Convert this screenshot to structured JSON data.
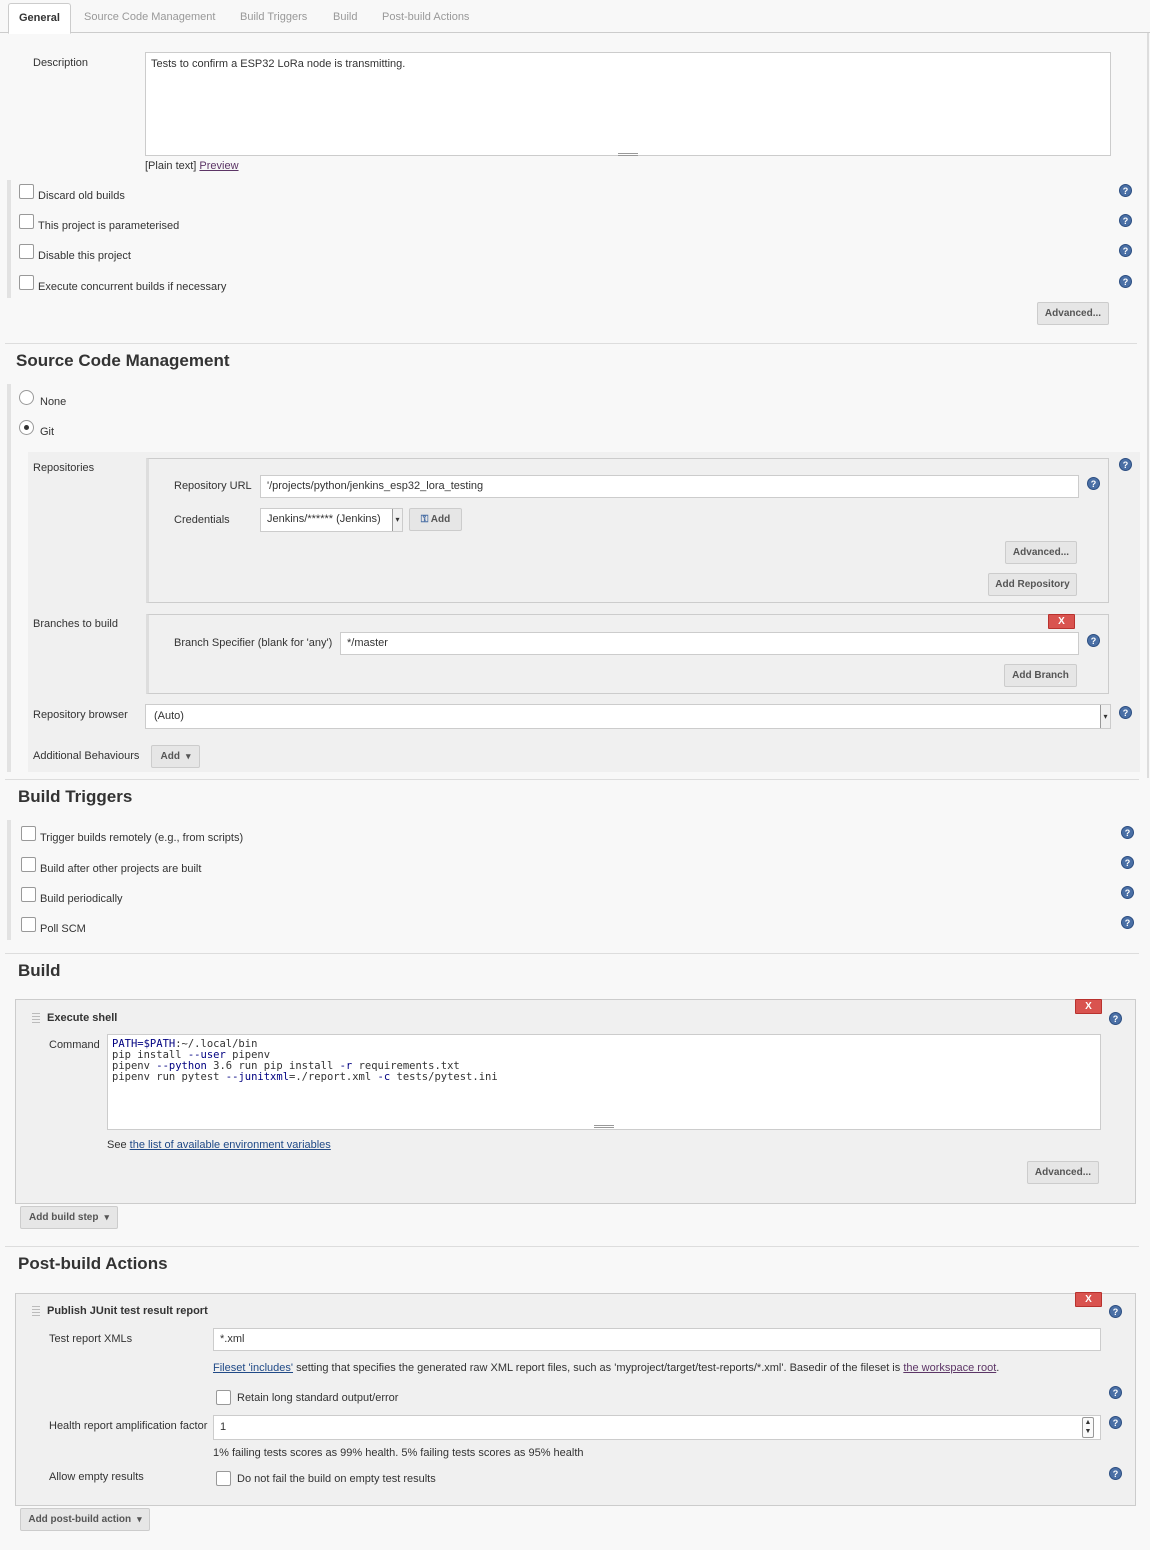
{
  "tabs": [
    "General",
    "Source Code Management",
    "Build Triggers",
    "Build",
    "Post-build Actions"
  ],
  "general": {
    "description_label": "Description",
    "description_value": "Tests to confirm a ESP32 LoRa node is transmitting.",
    "plain_text": "[Plain text]",
    "preview": "Preview",
    "options": [
      "Discard old builds",
      "This project is parameterised",
      "Disable this project",
      "Execute concurrent builds if necessary"
    ],
    "advanced": "Advanced..."
  },
  "scm": {
    "heading": "Source Code Management",
    "none_label": "None",
    "git_label": "Git",
    "repositories_label": "Repositories",
    "repo_url_label": "Repository URL",
    "repo_url_value": "'/projects/python/jenkins_esp32_lora_testing",
    "credentials_label": "Credentials",
    "credentials_value": "Jenkins/****** (Jenkins)",
    "add_cred": "Add",
    "advanced": "Advanced...",
    "add_repository": "Add Repository",
    "branches_label": "Branches to build",
    "x": "X",
    "branch_spec_label": "Branch Specifier (blank for 'any')",
    "branch_spec_value": "*/master",
    "add_branch": "Add Branch",
    "repo_browser_label": "Repository browser",
    "repo_browser_value": "(Auto)",
    "additional_label": "Additional Behaviours",
    "add": "Add"
  },
  "triggers": {
    "heading": "Build Triggers",
    "options": [
      "Trigger builds remotely (e.g., from scripts)",
      "Build after other projects are built",
      "Build periodically",
      "Poll SCM"
    ]
  },
  "build": {
    "heading": "Build",
    "step_title": "Execute shell",
    "x": "X",
    "command_label": "Command",
    "command_lines": [
      "PATH=$PATH:~/.local/bin",
      "pip install --user pipenv",
      "pipenv --python 3.6 run pip install -r requirements.txt",
      "pipenv run pytest --junitxml=./report.xml -c tests/pytest.ini"
    ],
    "see": "See",
    "env_link": "the list of available environment variables",
    "advanced": "Advanced...",
    "add_step": "Add build step"
  },
  "post": {
    "heading": "Post-build Actions",
    "title": "Publish JUnit test result report",
    "x": "X",
    "xml_label": "Test report XMLs",
    "xml_value": "*.xml",
    "fileset_link": "Fileset 'includes'",
    "fileset_text": " setting that specifies the generated raw XML report files, such as 'myproject/target/test-reports/*.xml'. Basedir of the fileset is ",
    "workspace_link": "the workspace root",
    "period": ".",
    "retain_label": "Retain long standard output/error",
    "health_label": "Health report amplification factor",
    "health_value": "1",
    "health_hint": "1% failing tests scores as 99% health. 5% failing tests scores as 95% health",
    "allow_label": "Allow empty results",
    "allow_cb": "Do not fail the build on empty test results",
    "add_action": "Add post-build action"
  },
  "help_icon": "?"
}
